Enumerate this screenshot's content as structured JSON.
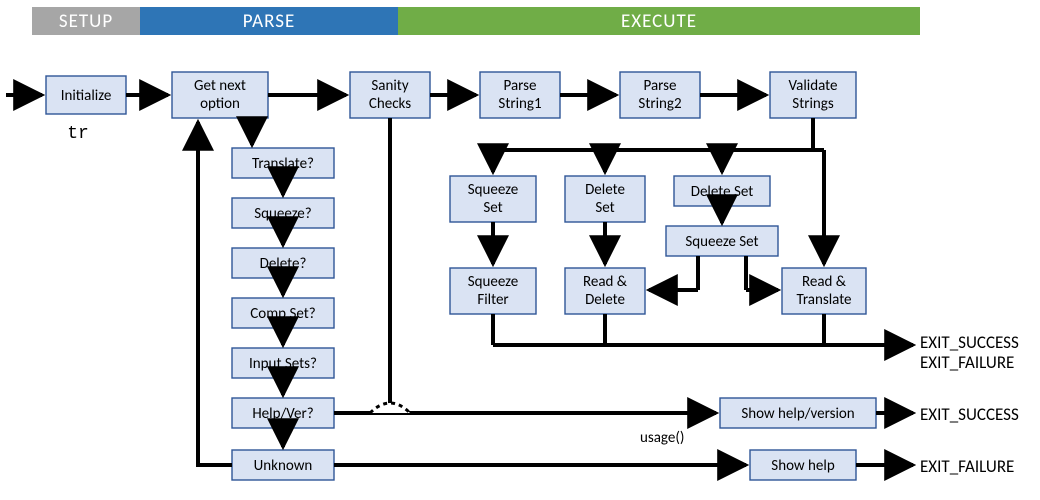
{
  "phases": {
    "setup": "SETUP",
    "parse": "PARSE",
    "execute": "EXECUTE"
  },
  "nodes": {
    "initialize": "Initialize",
    "get_next_option1": "Get next",
    "get_next_option2": "option",
    "sanity1": "Sanity",
    "sanity2": "Checks",
    "parse_s1a": "Parse",
    "parse_s1b": "String1",
    "parse_s2a": "Parse",
    "parse_s2b": "String2",
    "validate1": "Validate",
    "validate2": "Strings",
    "translate_q": "Translate?",
    "squeeze_q": "Squeeze?",
    "delete_q": "Delete?",
    "comp_set_q": "Comp Set?",
    "input_sets_q": "Input Sets?",
    "help_ver_q": "Help/Ver?",
    "unknown": "Unknown",
    "squeeze_set_a1": "Squeeze",
    "squeeze_set_a2": "Set",
    "delete_set_a1": "Delete",
    "delete_set_a2": "Set",
    "delete_set_b": "Delete Set",
    "squeeze_set_b": "Squeeze Set",
    "squeeze_filter1": "Squeeze",
    "squeeze_filter2": "Filter",
    "read_delete1": "Read &",
    "read_delete2": "Delete",
    "read_translate1": "Read &",
    "read_translate2": "Translate",
    "show_help_ver": "Show help/version",
    "show_help": "Show help"
  },
  "labels": {
    "tr": "tr",
    "usage": "usage()",
    "exit_success": "EXIT_SUCCESS",
    "exit_failure": "EXIT_FAILURE"
  }
}
